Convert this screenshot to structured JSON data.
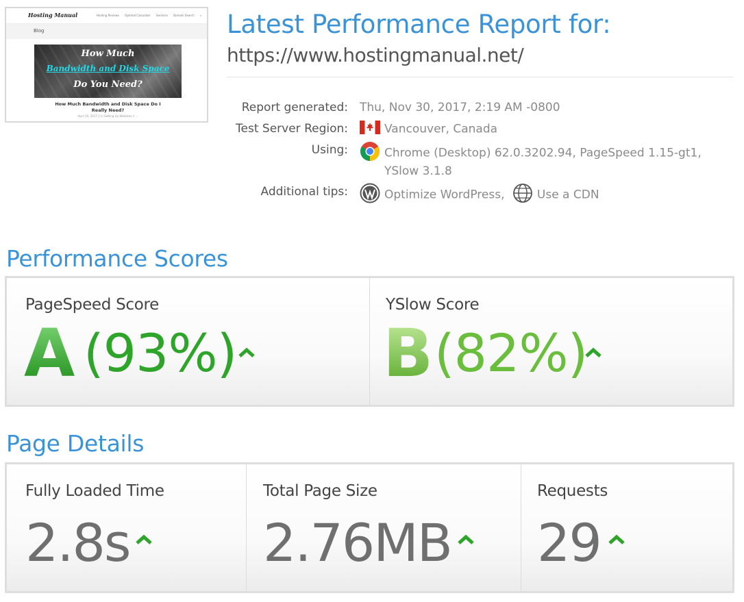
{
  "thumbnail": {
    "site_logo": "Hosting Manual",
    "nav": [
      "Hosting Reviews",
      "Optimal Calculator",
      "Services",
      "Domain Search",
      "⌕"
    ],
    "blog_label": "Blog",
    "hero_lines": [
      "How Much",
      "Bandwidth and Disk Space",
      "Do You Need?"
    ],
    "post_title": "How Much Bandwidth and Disk Space Do I Really Need?",
    "post_meta": "April 19, 2017 // in Setting Up Websites // ..."
  },
  "header": {
    "title": "Latest Performance Report for:",
    "url": "https://www.hostingmanual.net/"
  },
  "report_info": [
    {
      "label": "Report generated:",
      "value": "Thu, Nov 30, 2017, 2:19 AM -0800",
      "icon": ""
    },
    {
      "label": "Test Server Region:",
      "value": "Vancouver, Canada",
      "icon": "canada-flag-icon"
    },
    {
      "label": "Using:",
      "value": "Chrome (Desktop) 62.0.3202.94, PageSpeed 1.15-gt1,",
      "value2": "YSlow 3.1.8",
      "icon": "chrome-icon"
    },
    {
      "label": "Additional tips:",
      "tips": [
        "Optimize WordPress,",
        "Use a CDN"
      ],
      "icons": [
        "wordpress-icon",
        "globe-icon"
      ]
    }
  ],
  "performance": {
    "section_title": "Performance Scores",
    "pagespeed": {
      "label": "PageSpeed Score",
      "grade": "A",
      "percent": "(93%)",
      "color": "#2ea52a",
      "letter_top": "#6fd26a",
      "letter_bottom": "#1f8f1c"
    },
    "yslow": {
      "label": "YSlow Score",
      "grade": "B",
      "percent": "(82%)",
      "color": "#6bbd3e",
      "letter_top": "#b8e48e",
      "letter_bottom": "#5aa92c"
    }
  },
  "details": {
    "section_title": "Page Details",
    "fully_loaded": {
      "label": "Fully Loaded Time",
      "value": "2.8s"
    },
    "page_size": {
      "label": "Total Page Size",
      "value": "2.76MB"
    },
    "requests": {
      "label": "Requests",
      "value": "29"
    }
  },
  "colors": {
    "accent": "#3a93d6",
    "arrow_green": "#2ea52a"
  }
}
